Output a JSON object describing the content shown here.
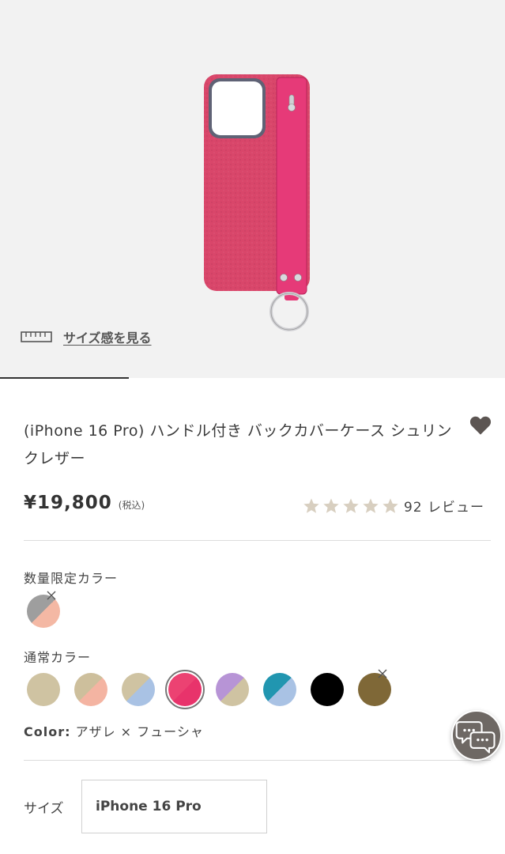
{
  "product": {
    "title": "(iPhone 16 Pro) ハンドル付き バックカバーケース シュリンクレザー",
    "price": "¥19,800",
    "tax_note": "(税込)",
    "rating_value": 5,
    "review_count": "92 レビュー"
  },
  "hero": {
    "size_link_label": "サイズ感を見る",
    "gallery_progress": 0.255
  },
  "colors": {
    "limited_label": "数量限定カラー",
    "regular_label": "通常カラー",
    "selected_prefix": "Color:",
    "selected_name": "アザレ × フューシャ",
    "limited_swatches": [
      {
        "name": "gray-pink",
        "c1": "#9e9e9e",
        "c2": "#f4b8a4",
        "sold_out": true
      }
    ],
    "regular_swatches": [
      {
        "name": "beige",
        "c1": "#cfc3a2",
        "c2": "#cfc3a2",
        "sold_out": false,
        "selected": false
      },
      {
        "name": "beige-pink",
        "c1": "#cdbf9c",
        "c2": "#f4b4a2",
        "sold_out": false,
        "selected": false
      },
      {
        "name": "beige-blue",
        "c1": "#cfc3a2",
        "c2": "#a9c2e4",
        "sold_out": false,
        "selected": false
      },
      {
        "name": "azalea-fuchsia",
        "c1": "#ec4272",
        "c2": "#e8336b",
        "sold_out": false,
        "selected": true
      },
      {
        "name": "lavender-beige",
        "c1": "#b794d6",
        "c2": "#cfc3a2",
        "sold_out": false,
        "selected": false
      },
      {
        "name": "teal-blue",
        "c1": "#2196b0",
        "c2": "#a9c2e4",
        "sold_out": false,
        "selected": false
      },
      {
        "name": "black",
        "c1": "#000000",
        "c2": "#000000",
        "sold_out": false,
        "selected": false
      },
      {
        "name": "olive-brown",
        "c1": "#7f6837",
        "c2": "#7f6837",
        "sold_out": true,
        "selected": false
      }
    ]
  },
  "size": {
    "label": "サイズ",
    "selected": "iPhone 16 Pro"
  },
  "theme": {
    "star_color": "#d8cfc0",
    "text_color": "#3a3a3a",
    "chat_color": "#6e6864",
    "case_color": "#d9466a",
    "strap_color": "#e63a78"
  },
  "icons": {
    "ruler": "ruler-icon",
    "favorite": "heart-icon",
    "star": "star-icon",
    "chat": "chat-bubbles-icon",
    "sold_out": "x-icon"
  }
}
